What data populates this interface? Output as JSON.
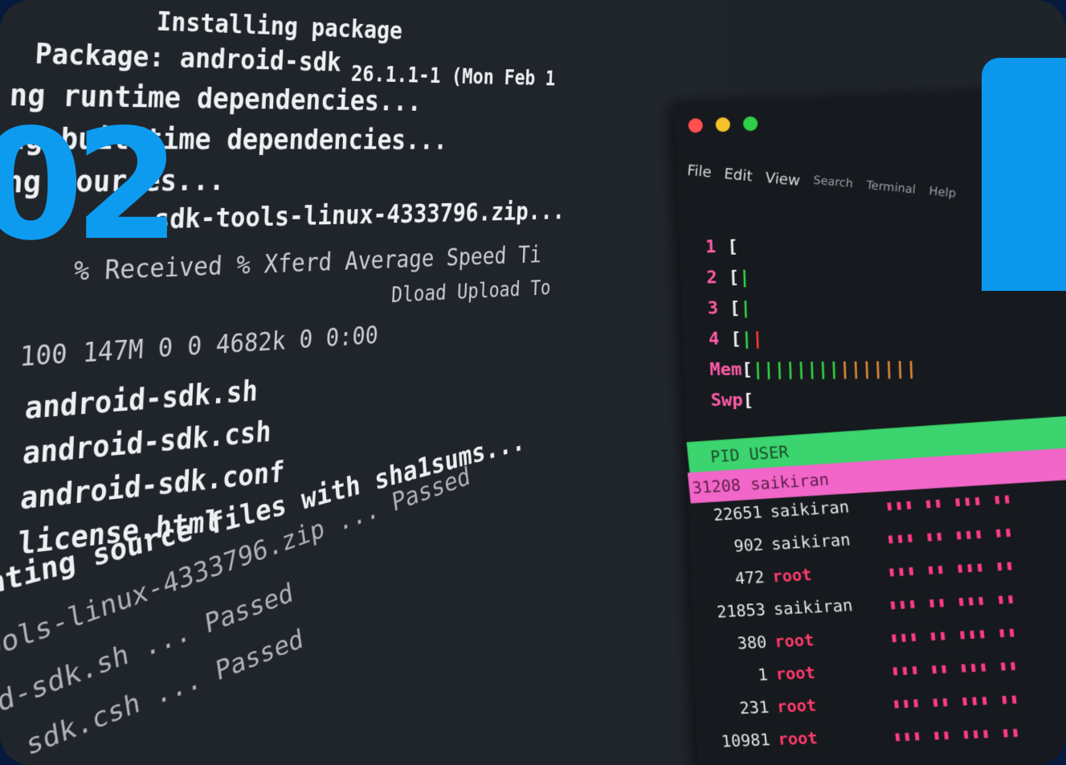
{
  "badge": "02",
  "terminal_left": {
    "lines": [
      "Installing package",
      "Package: android-sdk",
      "ng runtime dependencies...",
      "ng buildtime dependencies...",
      "ng sources...",
      "sdk-tools-linux-4333796.zip...",
      "% Received % Xferd  Average Speed   Ti",
      "Dload  Upload   To",
      "100  147M    0     0  4682k      0  0:00",
      "android-sdk.sh",
      "android-sdk.csh",
      "android-sdk.conf",
      "license.html",
      "ating source files with sha1sums...",
      "ools-linux-4333796.zip ... Passed",
      "d-sdk.sh ... Passed",
      "sdk.csh ... Passed",
      "Passed"
    ],
    "header_tail": "26.1.1-1 (Mon Feb 1"
  },
  "htop": {
    "window_buttons": [
      "close-button",
      "minimize-button",
      "maximize-button"
    ],
    "colors": {
      "close": "#ff4f4f",
      "minimize": "#f4c12a",
      "maximize": "#2fcf49",
      "header": "#3bd46e",
      "selected": "#f266c9"
    },
    "menu": [
      "File",
      "Edit",
      "View",
      "Search",
      "Terminal",
      "Help"
    ],
    "cpu_rows": [
      "1",
      "2",
      "3",
      "4"
    ],
    "mem_label": "Mem",
    "swp_label": "Swp",
    "header": "PID USER",
    "processes": [
      {
        "pid": "31208",
        "user": "saikiran"
      },
      {
        "pid": "22651",
        "user": "saikiran"
      },
      {
        "pid": "902",
        "user": "saikiran"
      },
      {
        "pid": "472",
        "user": "root"
      },
      {
        "pid": "21853",
        "user": "saikiran"
      },
      {
        "pid": "380",
        "user": "root"
      },
      {
        "pid": "1",
        "user": "root"
      },
      {
        "pid": "231",
        "user": "root"
      },
      {
        "pid": "10981",
        "user": "root"
      }
    ]
  }
}
